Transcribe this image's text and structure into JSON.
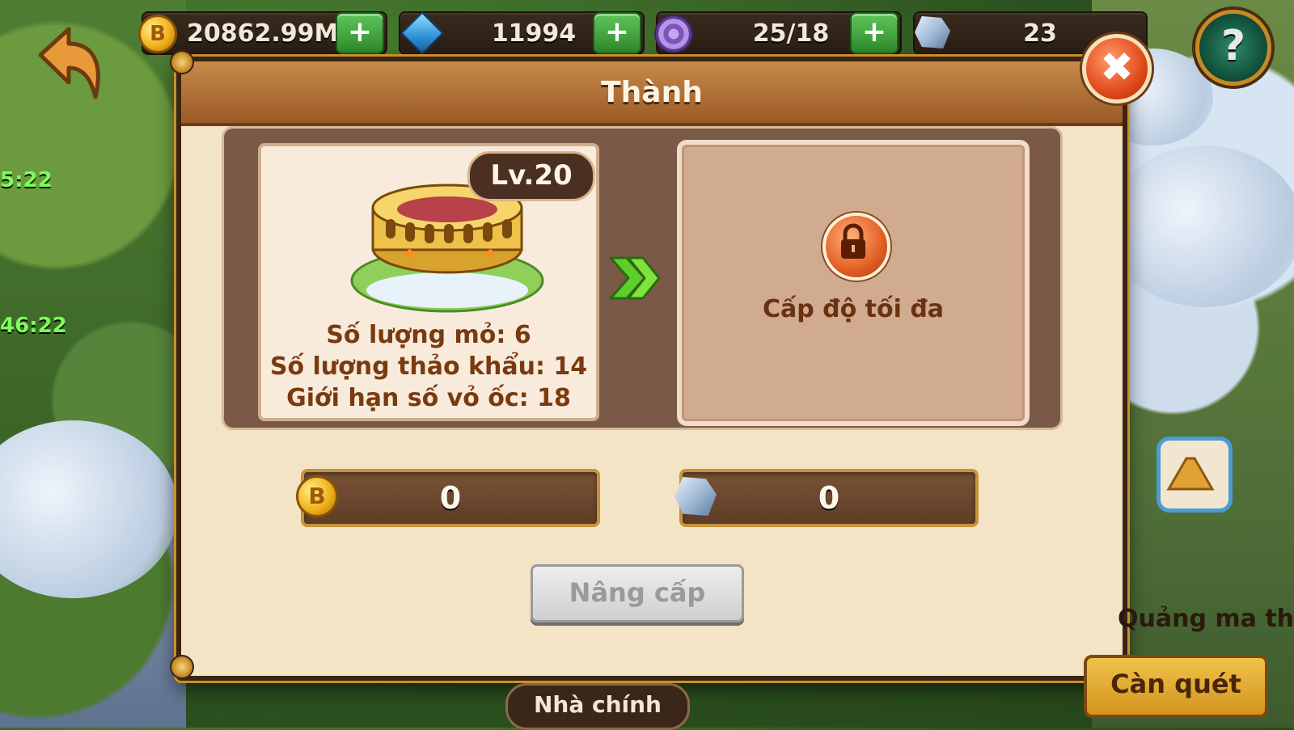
{
  "resources": {
    "gold": "20862.99M",
    "gems": "11994",
    "energy": "25/18",
    "ore": "23"
  },
  "dialog": {
    "title": "Thành",
    "current": {
      "level": "Lv.20",
      "stats": [
        "Số lượng mỏ: 6",
        "Số lượng thảo khẩu: 14",
        "Giới hạn số vỏ ốc: 18"
      ]
    },
    "next": {
      "locked_text": "Cấp độ tối đa"
    },
    "costs": {
      "gold": "0",
      "ore": "0"
    },
    "upgrade_label": "Nâng cấp"
  },
  "map": {
    "timer_1": "5:22",
    "timer_2": "46:22",
    "main_house_label": "Nhà chính",
    "magic_label": "Quảng ma thuật",
    "sweep_label": "Càn quét"
  },
  "colors": {
    "title_bar": "#b57439",
    "dialog_bg": "#f3e4c6",
    "plus_green": "#3fa33b",
    "close_red": "#e24a1a"
  }
}
